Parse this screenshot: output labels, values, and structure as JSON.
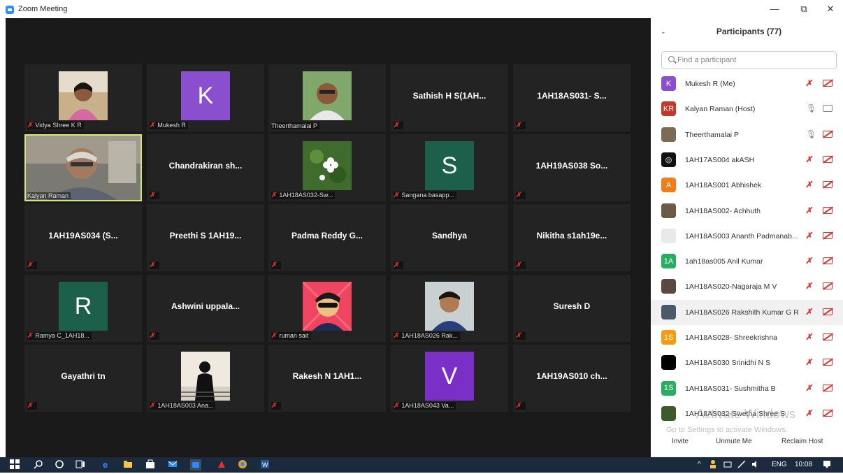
{
  "window": {
    "title": "Zoom Meeting",
    "minimize": "—",
    "maximize": "⧉",
    "close": "✕"
  },
  "gallery": {
    "tiles": [
      {
        "kind": "photo",
        "label": "Vidya Shree K R"
      },
      {
        "kind": "avatar",
        "letter": "K",
        "color": "#8a4fcf",
        "label": "Mukesh R"
      },
      {
        "kind": "photo",
        "label": "Theerthamalai P",
        "label_muted": false
      },
      {
        "kind": "name",
        "name": "Sathish H S(1AH..."
      },
      {
        "kind": "name",
        "name": "1AH18AS031- S..."
      },
      {
        "kind": "video",
        "label": "Kalyan Raman",
        "label_muted": false,
        "active": true
      },
      {
        "kind": "name",
        "name": "Chandrakiran sh..."
      },
      {
        "kind": "photo",
        "label": "1AH18AS032-Sw..."
      },
      {
        "kind": "avatar",
        "letter": "S",
        "color": "#1c5f4a",
        "label": "Sangana basapp..."
      },
      {
        "kind": "name",
        "name": "1AH19AS038 So..."
      },
      {
        "kind": "name",
        "name": "1AH19AS034 (S..."
      },
      {
        "kind": "name",
        "name": "Preethi S 1AH19..."
      },
      {
        "kind": "name",
        "name": "Padma Reddy G..."
      },
      {
        "kind": "name",
        "name": "Sandhya"
      },
      {
        "kind": "name",
        "name": "Nikitha s1ah19e..."
      },
      {
        "kind": "avatar",
        "letter": "R",
        "color": "#1c5f4a",
        "label": "Ramya C_1AH18..."
      },
      {
        "kind": "name",
        "name": "Ashwini uppala..."
      },
      {
        "kind": "photo",
        "label": "ruman sait"
      },
      {
        "kind": "photo",
        "label": "1AH18AS026 Rak..."
      },
      {
        "kind": "name",
        "name": "Suresh D"
      },
      {
        "kind": "name",
        "name": "Gayathri tn"
      },
      {
        "kind": "photo",
        "label": "1AH18AS003 Ana..."
      },
      {
        "kind": "name",
        "name": "Rakesh N 1AH1..."
      },
      {
        "kind": "avatar",
        "letter": "V",
        "color": "#7a2fc7",
        "label": "1AH18AS043 Va..."
      },
      {
        "kind": "name",
        "name": "1AH19AS010 ch..."
      }
    ]
  },
  "panel": {
    "title": "Participants (77)",
    "search_placeholder": "Find a participant",
    "participants": [
      {
        "name": "Mukesh R (Me)",
        "avatar": "K",
        "color": "#8a4fcf",
        "mic": "off",
        "cam": "off"
      },
      {
        "name": "Kalyan Raman (Host)",
        "avatar": "KR",
        "color": "#c0392b",
        "mic": "on",
        "cam": "on"
      },
      {
        "name": "Theerthamalai P",
        "avatar": "",
        "color": "#7d6a55",
        "mic": "on",
        "cam": "off"
      },
      {
        "name": "1AH17AS004 akASH",
        "avatar": "◎",
        "color": "#111111",
        "mic": "off",
        "cam": "off"
      },
      {
        "name": "1AH18AS001 Abhishek",
        "avatar": "A",
        "color": "#ef7d1a",
        "mic": "off",
        "cam": "off"
      },
      {
        "name": "1AH18AS002- Achhuth",
        "avatar": "",
        "color": "#6b5b45",
        "mic": "off",
        "cam": "off"
      },
      {
        "name": "1AH18AS003 Ananth Padmanab...",
        "avatar": "",
        "color": "#e9e9e9",
        "mic": "off",
        "cam": "off"
      },
      {
        "name": "1ah18as005 Anil Kumar",
        "avatar": "1A",
        "color": "#27ae60",
        "mic": "off",
        "cam": "off"
      },
      {
        "name": "1AH18AS020-Nagaraja M V",
        "avatar": "",
        "color": "#5a4a40",
        "mic": "off",
        "cam": "off"
      },
      {
        "name": "1AH18AS026 Rakshith Kumar G R",
        "avatar": "",
        "color": "#4a5a6a",
        "mic": "off",
        "cam": "off",
        "highlight": true
      },
      {
        "name": "1AH18AS028- Shreekrishna",
        "avatar": "1S",
        "color": "#f39c12",
        "mic": "off",
        "cam": "off"
      },
      {
        "name": "1AH18AS030 Srinidhi N S",
        "avatar": "",
        "color": "#000000",
        "mic": "off",
        "cam": "off"
      },
      {
        "name": "1AH18AS031- Sushmitha B",
        "avatar": "1S",
        "color": "#27ae60",
        "mic": "off",
        "cam": "off"
      },
      {
        "name": "1AH18AS032-Swetha Shree S",
        "avatar": "",
        "color": "#3d5a2a",
        "mic": "off",
        "cam": "off"
      }
    ],
    "watermark_title": "Activate Windows",
    "watermark_sub": "Go to Settings to activate Windows.",
    "footer": {
      "invite": "Invite",
      "unmute": "Unmute Me",
      "reclaim": "Reclaim Host"
    }
  },
  "taskbar": {
    "lang": "ENG",
    "time": "10:08"
  }
}
